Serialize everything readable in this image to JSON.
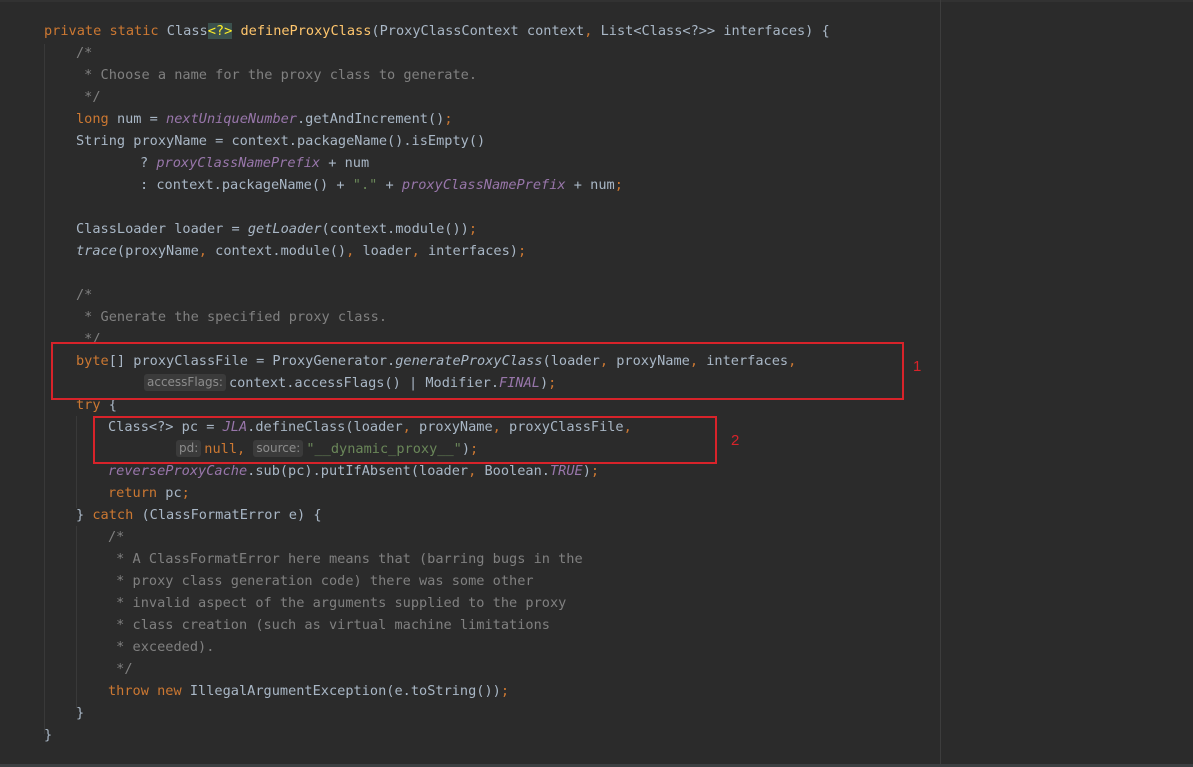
{
  "code": {
    "method_signature": {
      "mod_private": "private",
      "mod_static": "static",
      "ret_type": "Class",
      "wildcard": "<?>",
      "method_name": "defineProxyClass",
      "params_open": "(ProxyClassContext context",
      "params_rest": "List<Class<?>> interfaces) {"
    },
    "comment1": [
      "/*",
      " * Choose a name for the proxy class to generate.",
      " */"
    ],
    "num_line": {
      "kw": "long",
      "mid": "num = ",
      "field": "nextUniqueNumber",
      "rest": ".getAndIncrement()"
    },
    "proxyname_line": "String proxyName = context.packageName().isEmpty()",
    "ternary1": {
      "lead": "? ",
      "field": "proxyClassNamePrefix",
      "rest": " + num"
    },
    "ternary2": {
      "lead": ": context.packageName() + ",
      "str": "\".\"",
      "mid": " + ",
      "field": "proxyClassNamePrefix",
      "rest": " + num"
    },
    "loader_line": {
      "lead": "ClassLoader loader = ",
      "method": "getLoader",
      "rest": "(context.module())"
    },
    "trace_line": {
      "method": "trace",
      "a": "(proxyName",
      "b": " context.module()",
      "c": " loader",
      "d": " interfaces)"
    },
    "comment2": [
      "/*",
      " * Generate the specified proxy class.",
      " */"
    ],
    "bytes_line": {
      "kw": "byte",
      "a": "[] proxyClassFile = ProxyGenerator.",
      "method": "generateProxyClass",
      "b": "(loader",
      "c": " proxyName",
      "d": " interfaces"
    },
    "bytes_line2": {
      "hint": "accessFlags:",
      "a": "context.accessFlags() | Modifier.",
      "field": "FINAL",
      "b": ")"
    },
    "try_line": {
      "kw": "try",
      "rest": " {"
    },
    "define_line": {
      "a": "Class<?> pc = ",
      "field": "JLA",
      "b": ".defineClass(loader",
      "c": " proxyName",
      "d": " proxyClassFile"
    },
    "define_line2": {
      "hint1": "pd:",
      "kw": "null",
      "hint2": "source:",
      "str": "\"__dynamic_proxy__\"",
      "b": ")"
    },
    "cache_line": {
      "field": "reverseProxyCache",
      "a": ".sub(pc).putIfAbsent(loader",
      "b": " Boolean.",
      "field2": "TRUE",
      "c": ")"
    },
    "return_line": {
      "kw": "return",
      "rest": " pc"
    },
    "catch_line": {
      "a": "} ",
      "kw": "catch",
      "b": " (ClassFormatError e) {"
    },
    "comment3": [
      "/*",
      " * A ClassFormatError here means that (barring bugs in the",
      " * proxy class generation code) there was some other",
      " * invalid aspect of the arguments supplied to the proxy",
      " * class creation (such as virtual machine limitations",
      " * exceeded).",
      " */"
    ],
    "throw_line": {
      "kw1": "throw",
      "kw2": "new",
      "rest": " IllegalArgumentException(e.toString())"
    },
    "close_inner": "}",
    "close_outer": "}"
  },
  "annotations": [
    {
      "label": "1"
    },
    {
      "label": "2"
    }
  ],
  "colors": {
    "background": "#2b2b2b",
    "keyword": "#cc7832",
    "method_decl": "#ffc66d",
    "comment": "#808080",
    "string": "#6a8759",
    "field": "#9876aa",
    "text": "#a9b7c6",
    "annotation_box": "#d8232a"
  }
}
